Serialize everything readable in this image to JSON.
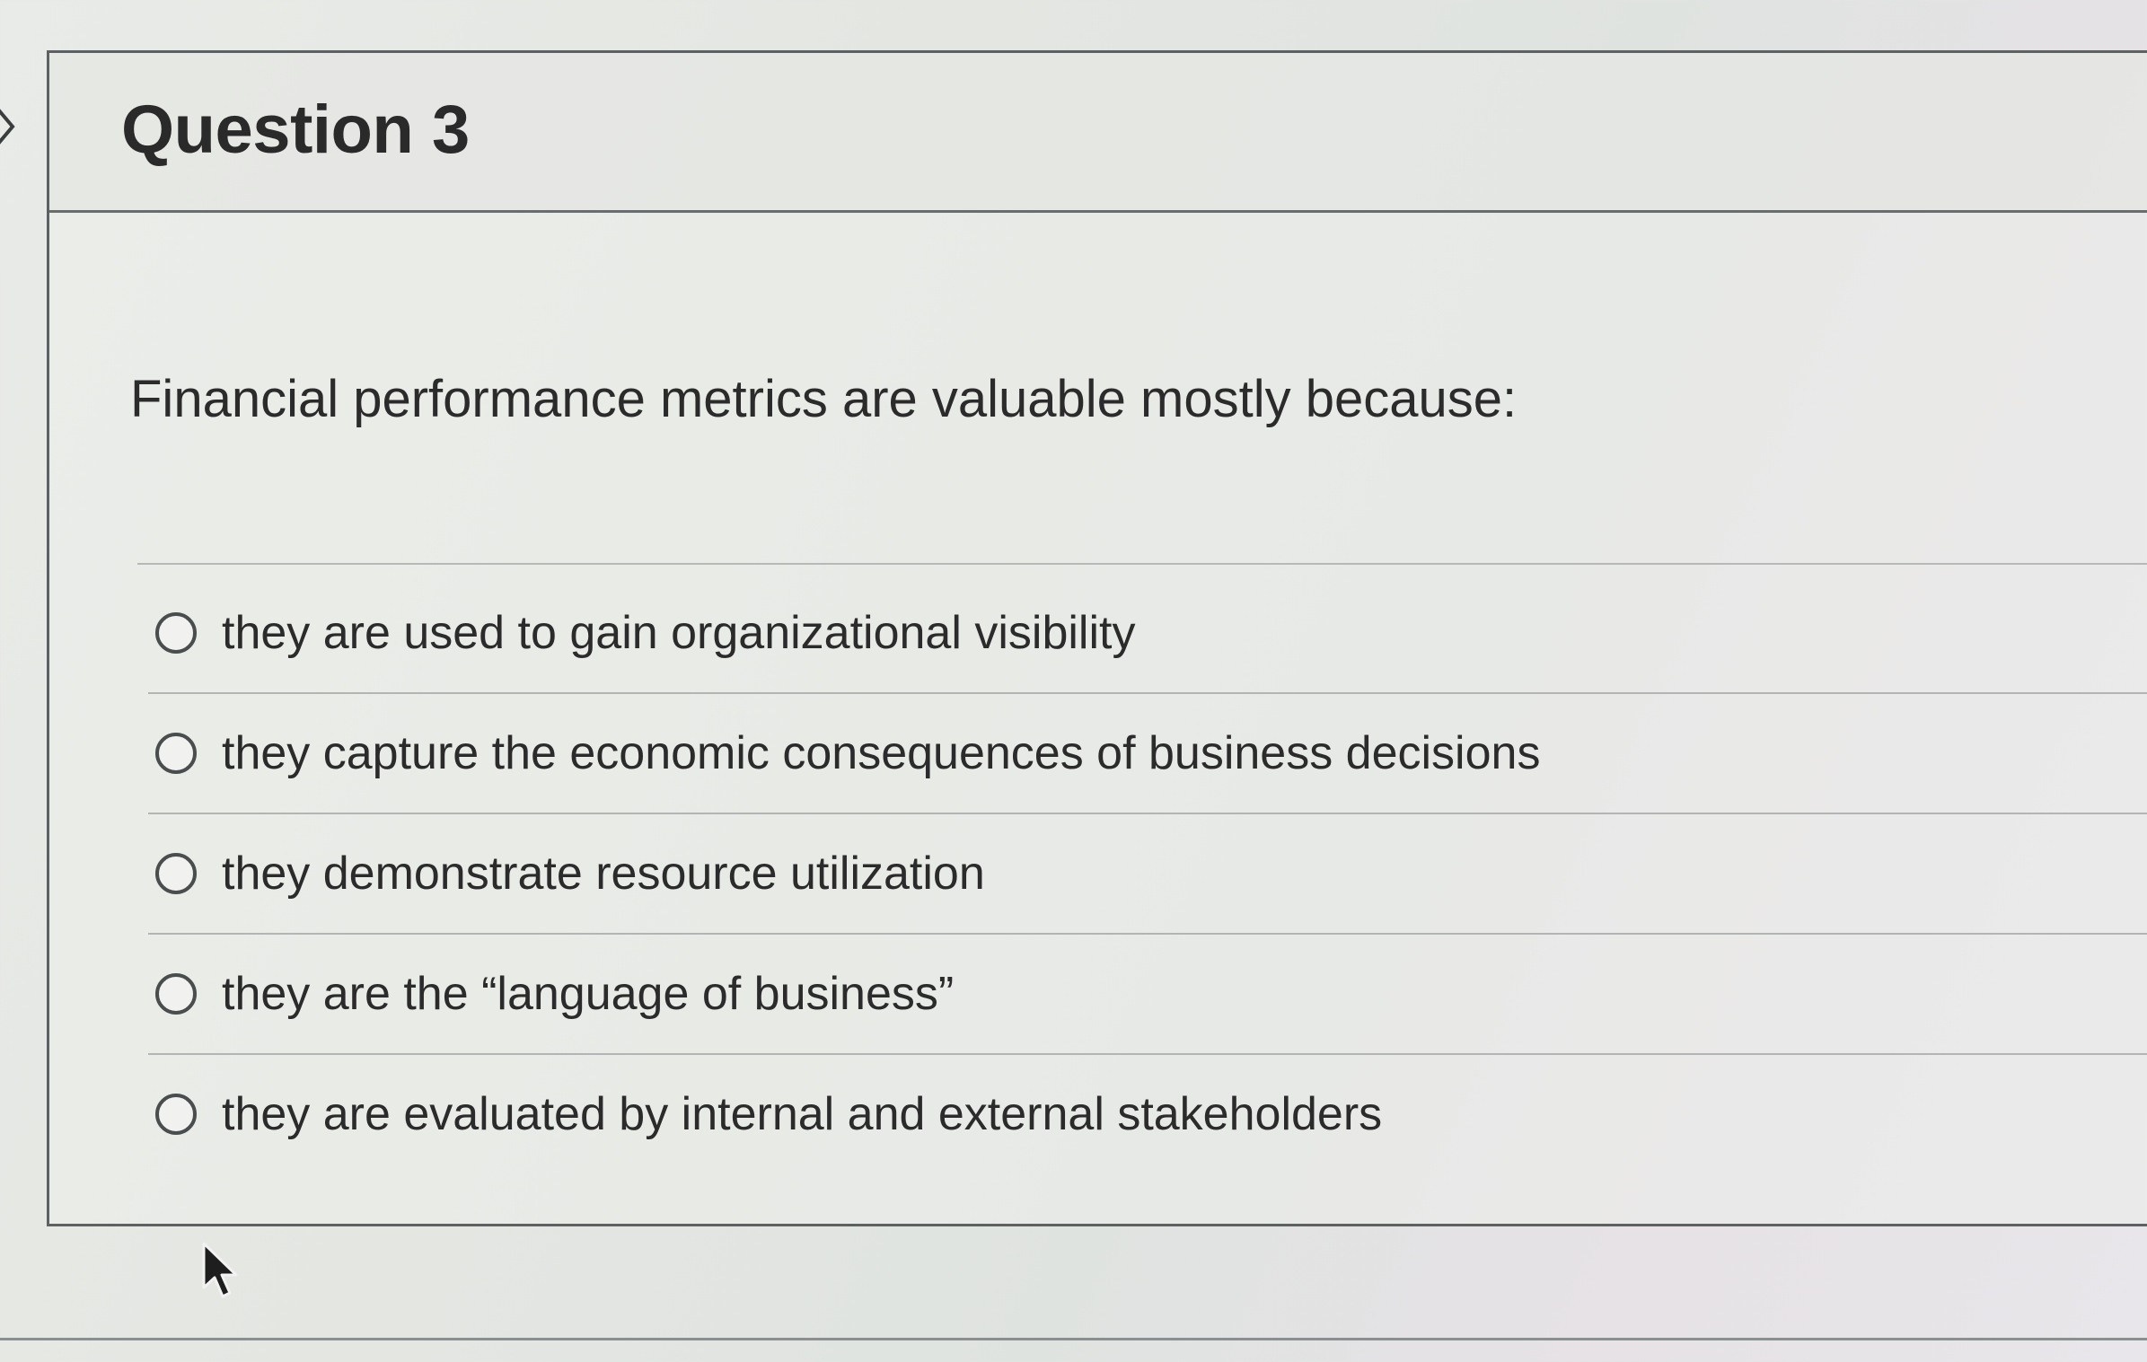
{
  "question": {
    "title": "Question 3",
    "prompt": "Financial performance metrics are valuable mostly because:",
    "options": [
      "they are used to gain organizational visibility",
      "they capture the economic consequences of business decisions",
      "they demonstrate resource utilization",
      "they are the “language of business”",
      "they are evaluated by internal and external stakeholders"
    ]
  },
  "icons": {
    "nav": "chevron-right-icon",
    "option_control": "radio-button-unselected",
    "pointer": "mouse-pointer-icon"
  },
  "colors": {
    "text": "#2b2b2b",
    "border": "#5e6162",
    "header_background": "#e2e4e1"
  }
}
